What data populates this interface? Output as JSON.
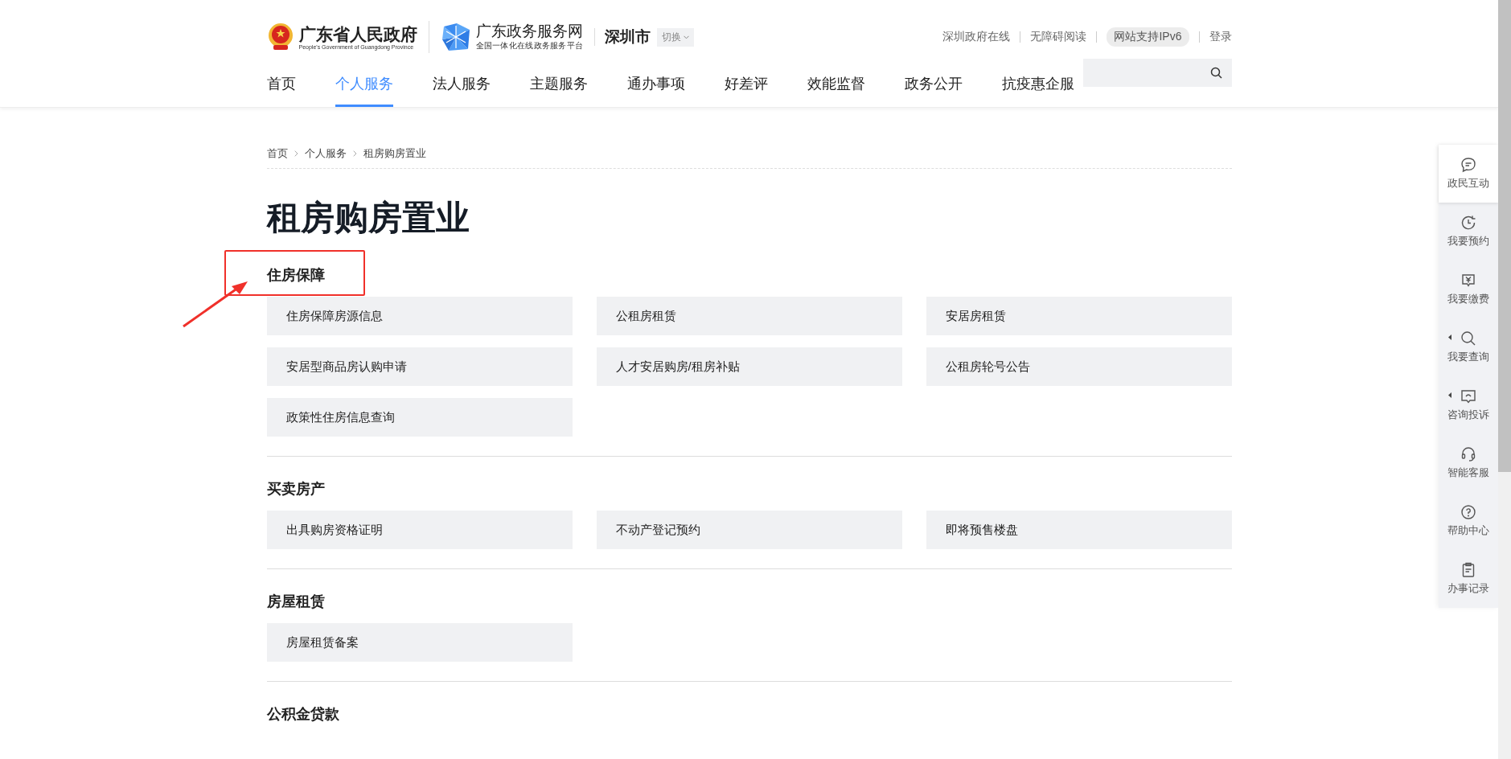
{
  "header": {
    "gov_logo": {
      "title": "广东省人民政府",
      "subtitle": "People's Government of Guangdong Province"
    },
    "portal_logo": {
      "title": "广东政务服务网",
      "subtitle": "全国一体化在线政务服务平台"
    },
    "city": {
      "name": "深圳市",
      "switch_label": "切换"
    },
    "top_links": [
      {
        "label": "深圳政府在线",
        "kind": "link"
      },
      {
        "label": "无障碍阅读",
        "kind": "link"
      },
      {
        "label": "网站支持IPv6",
        "kind": "pill"
      },
      {
        "label": "登录",
        "kind": "link"
      }
    ],
    "nav": [
      {
        "label": "首页",
        "selected": false
      },
      {
        "label": "个人服务",
        "selected": true
      },
      {
        "label": "法人服务",
        "selected": false
      },
      {
        "label": "主题服务",
        "selected": false
      },
      {
        "label": "通办事项",
        "selected": false
      },
      {
        "label": "好差评",
        "selected": false
      },
      {
        "label": "效能监督",
        "selected": false
      },
      {
        "label": "政务公开",
        "selected": false
      },
      {
        "label": "抗疫惠企服",
        "selected": false
      }
    ]
  },
  "breadcrumb": [
    "首页",
    "个人服务",
    "租房购房置业"
  ],
  "page_title": "租房购房置业",
  "sections": [
    {
      "heading": "住房保障",
      "items": [
        "住房保障房源信息",
        "公租房租赁",
        "安居房租赁",
        "安居型商品房认购申请",
        "人才安居购房/租房补贴",
        "公租房轮号公告",
        "政策性住房信息查询"
      ]
    },
    {
      "heading": "买卖房产",
      "items": [
        "出具购房资格证明",
        "不动产登记预约",
        "即将预售楼盘"
      ]
    },
    {
      "heading": "房屋租赁",
      "items": [
        "房屋租赁备案"
      ]
    },
    {
      "heading": "公积金贷款"
    }
  ],
  "sidebar": [
    {
      "label": "政民互动",
      "selected": true,
      "expandable": false
    },
    {
      "label": "我要预约",
      "selected": false,
      "expandable": false
    },
    {
      "label": "我要缴费",
      "selected": false,
      "expandable": false
    },
    {
      "label": "我要查询",
      "selected": false,
      "expandable": true
    },
    {
      "label": "咨询投诉",
      "selected": false,
      "expandable": true
    },
    {
      "label": "智能客服",
      "selected": false,
      "expandable": false
    },
    {
      "label": "帮助中心",
      "selected": false,
      "expandable": false
    },
    {
      "label": "办事记录",
      "selected": false,
      "expandable": false
    }
  ]
}
